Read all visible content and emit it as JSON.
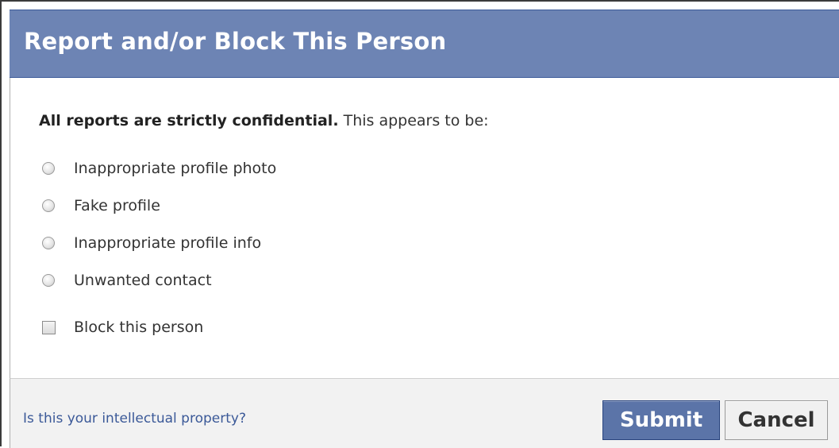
{
  "dialog": {
    "title": "Report and/or Block This Person",
    "intro_bold": "All reports are strictly confidential.",
    "intro_rest": " This appears to be:",
    "options": [
      {
        "label": "Inappropriate profile photo"
      },
      {
        "label": "Fake profile"
      },
      {
        "label": "Inappropriate profile info"
      },
      {
        "label": "Unwanted contact"
      }
    ],
    "block_label": "Block this person",
    "ip_link": "Is this your intellectual property?",
    "submit_label": "Submit",
    "cancel_label": "Cancel"
  },
  "colors": {
    "header_bg": "#6d84b4",
    "submit_bg": "#5b74a8",
    "link": "#3b5998",
    "footer_bg": "#f2f2f2"
  }
}
